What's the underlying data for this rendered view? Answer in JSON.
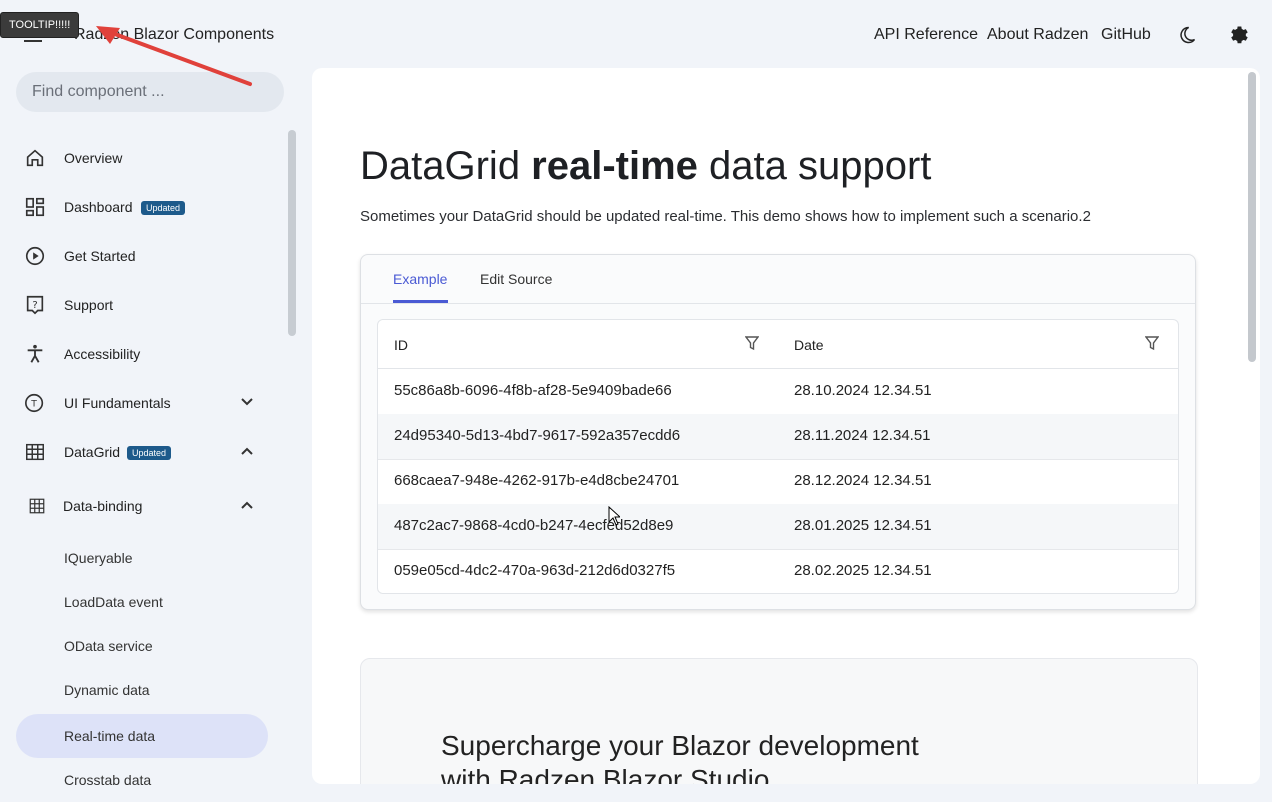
{
  "tooltip": "TOOLTIP!!!!!",
  "header": {
    "brand": "Radzen Blazor Components",
    "links": [
      "API Reference",
      "About Radzen",
      "GitHub"
    ]
  },
  "sidebar": {
    "search_placeholder": "Find component ...",
    "items": [
      {
        "label": "Overview",
        "icon": "home-icon"
      },
      {
        "label": "Dashboard",
        "icon": "dashboard-icon",
        "badge": "Updated"
      },
      {
        "label": "Get Started",
        "icon": "play-circle-icon"
      },
      {
        "label": "Support",
        "icon": "help-icon"
      },
      {
        "label": "Accessibility",
        "icon": "accessibility-icon"
      },
      {
        "label": "UI Fundamentals",
        "icon": "text-icon"
      },
      {
        "label": "DataGrid",
        "icon": "table-icon",
        "badge": "Updated"
      },
      {
        "label": "Data-binding",
        "icon": "grid-icon"
      }
    ],
    "sub_items": [
      "IQueryable",
      "LoadData event",
      "OData service",
      "Dynamic data",
      "Real-time data",
      "Crosstab data"
    ]
  },
  "main": {
    "title_pre": "DataGrid ",
    "title_bold": "real-time",
    "title_post": " data support",
    "description": "Sometimes your DataGrid should be updated real-time. This demo shows how to implement such a scenario.2",
    "tabs": [
      "Example",
      "Edit Source"
    ],
    "grid": {
      "columns": [
        "ID",
        "Date"
      ],
      "rows": [
        [
          "55c86a8b-6096-4f8b-af28-5e9409bade66",
          "28.10.2024 12.34.51"
        ],
        [
          "24d95340-5d13-4bd7-9617-592a357ecdd6",
          "28.11.2024 12.34.51"
        ],
        [
          "668caea7-948e-4262-917b-e4d8cbe24701",
          "28.12.2024 12.34.51"
        ],
        [
          "487c2ac7-9868-4cd0-b247-4ecfed52d8e9",
          "28.01.2025 12.34.51"
        ],
        [
          "059e05cd-4dc2-470a-963d-212d6d0327f5",
          "28.02.2025 12.34.51"
        ]
      ]
    },
    "promo_title": "Supercharge your Blazor development with Radzen Blazor Studio"
  },
  "colors": {
    "accent": "#4a5ad4",
    "badge": "#1d5a8b",
    "active_nav": "#dde2f8"
  }
}
